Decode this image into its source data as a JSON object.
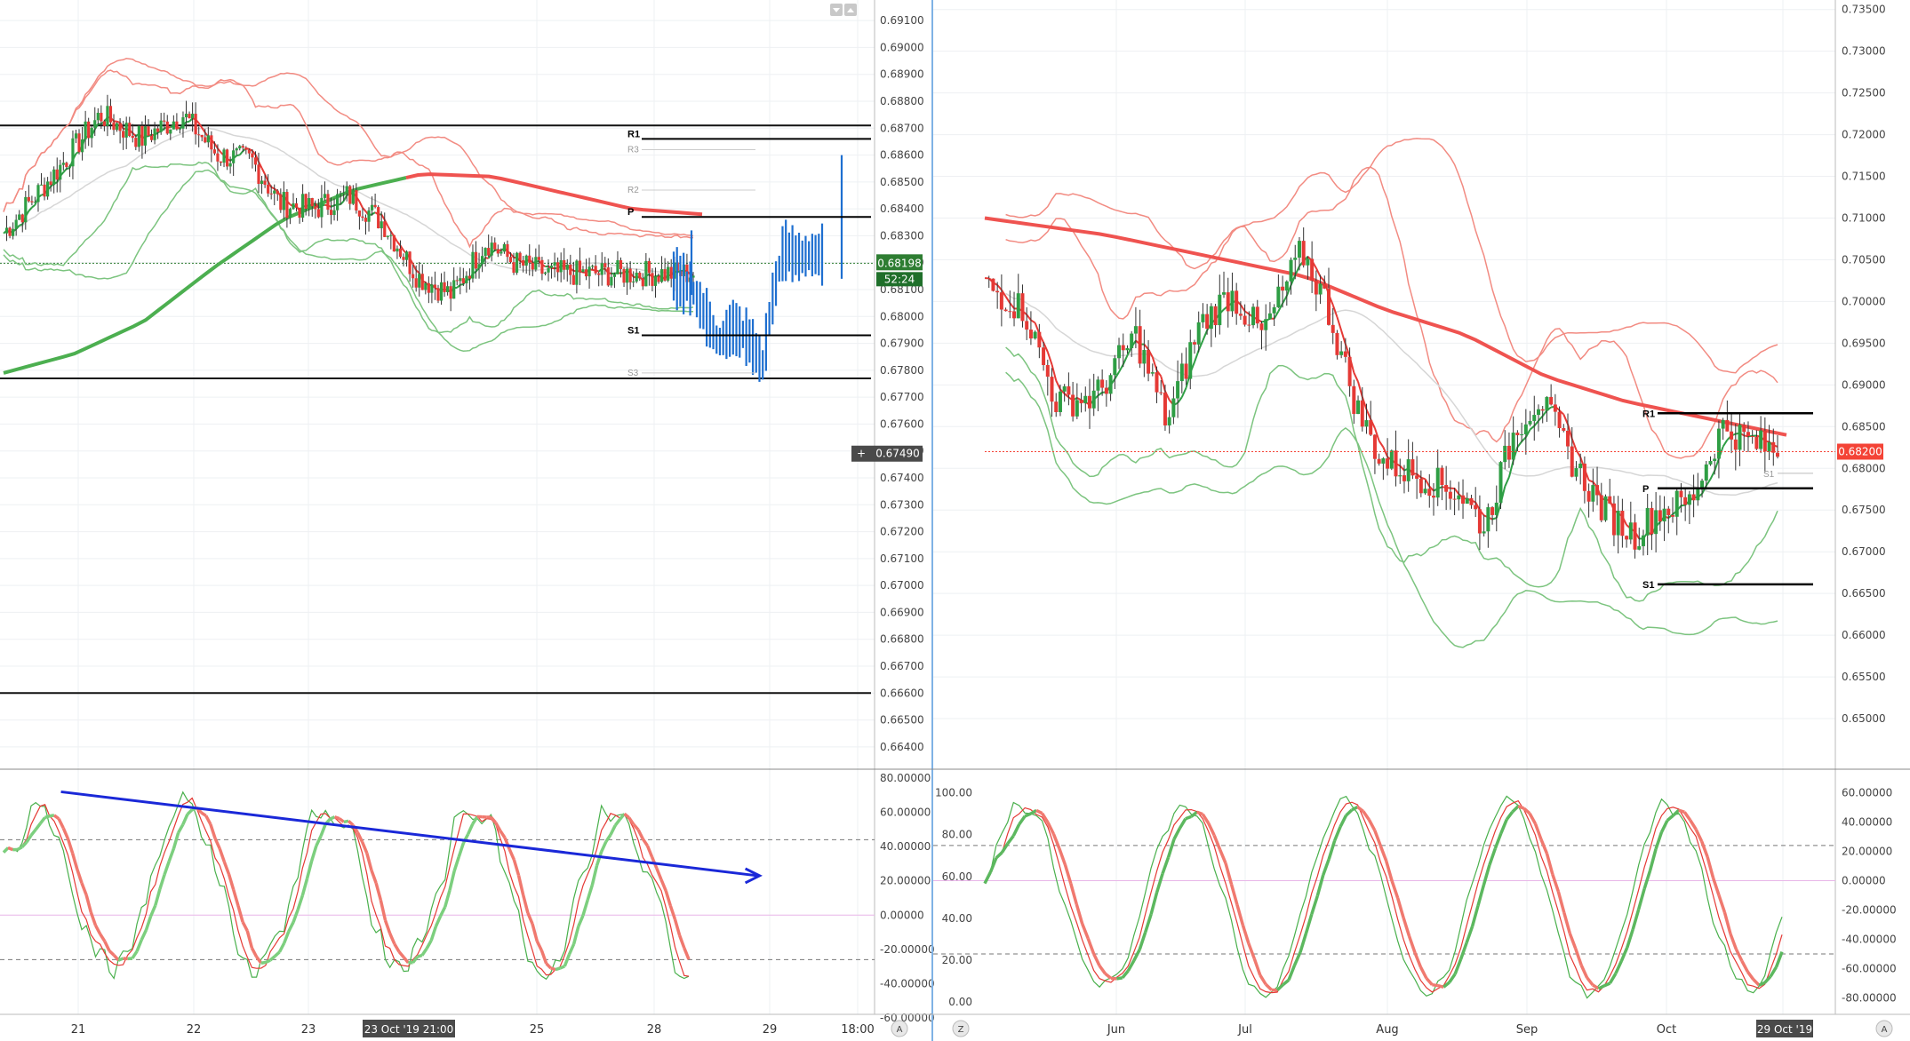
{
  "chart_data": [
    {
      "type": "candlestick",
      "instrument_panel": "left",
      "x_ticks": [
        "21",
        "22",
        "23",
        "25",
        "28",
        "29",
        "18:00"
      ],
      "crosshair_x_label": "23 Oct '19  21:00",
      "ylim": [
        0.6635,
        0.6915
      ],
      "y_ticks": [
        "0.69100",
        "0.69000",
        "0.68900",
        "0.68800",
        "0.68700",
        "0.68600",
        "0.68500",
        "0.68400",
        "0.68300",
        "0.68200",
        "0.68100",
        "0.68000",
        "0.67900",
        "0.67800",
        "0.67700",
        "0.67600",
        "0.67500",
        "0.67400",
        "0.67300",
        "0.67200",
        "0.67100",
        "0.67000",
        "0.66900",
        "0.66800",
        "0.66700",
        "0.66600",
        "0.66500",
        "0.66400"
      ],
      "price_tag": {
        "value": "0.68198",
        "countdown": "52:24",
        "color": "#2e7d32"
      },
      "crosshair_tag": "0.67490",
      "horizontal_lines": [
        0.6871,
        0.6777,
        0.666
      ],
      "pivots": [
        {
          "label": "R1",
          "value": 0.6866,
          "style": "bold"
        },
        {
          "label": "R3",
          "value": 0.6862,
          "style": "grey"
        },
        {
          "label": "R2",
          "value": 0.6847,
          "style": "grey"
        },
        {
          "label": "P",
          "value": 0.6837,
          "style": "bold"
        },
        {
          "label": "S1",
          "value": 0.6793,
          "style": "bold"
        },
        {
          "label": "S3",
          "value": 0.6779,
          "style": "grey"
        }
      ],
      "oscillator": {
        "ylim": [
          -60,
          80
        ],
        "y_ticks": [
          "80.00000",
          "60.00000",
          "40.00000",
          "20.00000",
          "0.00000",
          "-20.00000",
          "-40.00000",
          "-60.00000"
        ],
        "levels": [
          44,
          0,
          -26
        ],
        "trendline": [
          [
            0.07,
            72
          ],
          [
            0.87,
            23
          ]
        ]
      }
    },
    {
      "type": "candlestick",
      "instrument_panel": "right",
      "x_ticks": [
        "Jun",
        "Jul",
        "Aug",
        "Sep",
        "Oct",
        "29 Oct '19"
      ],
      "ylim": [
        0.645,
        0.7355
      ],
      "y_ticks": [
        "0.73500",
        "0.73000",
        "0.72500",
        "0.72000",
        "0.71500",
        "0.71000",
        "0.70500",
        "0.70000",
        "0.69500",
        "0.69000",
        "0.68500",
        "0.68000",
        "0.67500",
        "0.67000",
        "0.66500",
        "0.66000",
        "0.65500",
        "0.65000"
      ],
      "price_tag": {
        "value": "0.68200",
        "color": "#f44336"
      },
      "pivots": [
        {
          "label": "R1",
          "value": 0.6866,
          "style": "bold"
        },
        {
          "label": "P",
          "value": 0.6776,
          "style": "bold"
        },
        {
          "label": "S1",
          "value": 0.6661,
          "style": "bold"
        },
        {
          "label": "S1",
          "value": 0.6794,
          "style": "grey"
        }
      ],
      "oscillator": {
        "left_ylim": [
          -5,
          107
        ],
        "left_ticks": [
          "100.00",
          "80.00",
          "60.00",
          "40.00",
          "20.00",
          "0.00"
        ],
        "right_ticks": [
          "60.00000",
          "40.00000",
          "20.00000",
          "0.00000",
          "-20.00000",
          "-40.00000",
          "-60.00000",
          "-80.00000"
        ],
        "levels": [
          24,
          0,
          -50
        ]
      }
    }
  ],
  "ui": {
    "corner_left": "A",
    "corner_right": "A",
    "corner_z": "Z"
  },
  "colors": {
    "bull": "#2e9e44",
    "bear": "#e53935",
    "band_red": "#f28b82",
    "band_green": "#7cc47f",
    "sma_red": "#ef5350",
    "sma_green": "#4caf50",
    "blue_bars": "#1e6fd0",
    "trendline": "#1a28d8"
  }
}
